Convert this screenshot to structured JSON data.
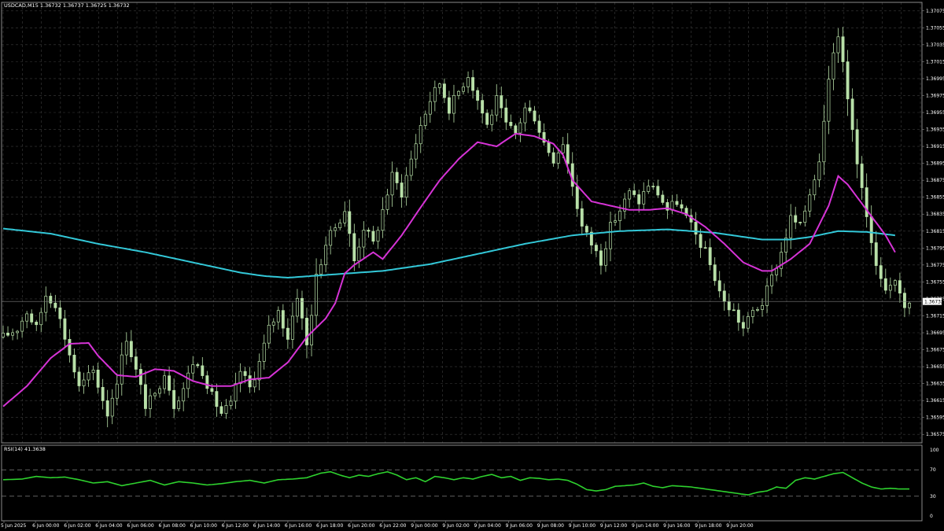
{
  "header": {
    "symbol_info": "USDCAD,M15  1.36732 1.36737 1.36725 1.36732"
  },
  "indicator": {
    "label": "RSI(14) 41.3638"
  },
  "colors": {
    "background": "#000000",
    "grid": "#3c3c3c",
    "candle_up": "#b8e0a8",
    "candle_down": "#b8e0a8",
    "ma_fast": "#d633d6",
    "ma_slow": "#33c8d8",
    "rsi": "#2ed12e",
    "text": "#ffffff"
  },
  "chart_data": {
    "type": "candlestick",
    "symbol": "USDCAD",
    "timeframe": "M15",
    "ylim": [
      1.36565,
      1.37085
    ],
    "y_ticks": [
      "1.37075",
      "1.37055",
      "1.37035",
      "1.37015",
      "1.36995",
      "1.36975",
      "1.36955",
      "1.36935",
      "1.36915",
      "1.36895",
      "1.36875",
      "1.36855",
      "1.36835",
      "1.36815",
      "1.36795",
      "1.36775",
      "1.36755",
      "1.36735",
      "1.36715",
      "1.36695",
      "1.36675",
      "1.36655",
      "1.36635",
      "1.36615",
      "1.36595",
      "1.36575"
    ],
    "current_price": "1.36732",
    "x_ticks": [
      "5 Jun 2025",
      "6 Jun 00:00",
      "6 Jun 02:00",
      "6 Jun 04:00",
      "6 Jun 06:00",
      "6 Jun 08:00",
      "6 Jun 10:00",
      "6 Jun 12:00",
      "6 Jun 14:00",
      "6 Jun 16:00",
      "6 Jun 18:00",
      "6 Jun 20:00",
      "6 Jun 22:00",
      "9 Jun 00:00",
      "9 Jun 02:00",
      "9 Jun 04:00",
      "9 Jun 06:00",
      "9 Jun 08:00",
      "9 Jun 10:00",
      "9 Jun 12:00",
      "9 Jun 14:00",
      "9 Jun 16:00",
      "9 Jun 18:00",
      "9 Jun 20:00"
    ],
    "close_path": [
      [
        0,
        1.3669
      ],
      [
        3,
        1.367
      ],
      [
        5,
        1.3672
      ],
      [
        7,
        1.367
      ],
      [
        9,
        1.3674
      ],
      [
        11,
        1.3673
      ],
      [
        13,
        1.3669
      ],
      [
        16,
        1.3663
      ],
      [
        19,
        1.3665
      ],
      [
        22,
        1.366
      ],
      [
        24,
        1.3664
      ],
      [
        26,
        1.3669
      ],
      [
        28,
        1.3665
      ],
      [
        30,
        1.3661
      ],
      [
        32,
        1.3662
      ],
      [
        34,
        1.3665
      ],
      [
        36,
        1.3661
      ],
      [
        38,
        1.3663
      ],
      [
        40,
        1.3666
      ],
      [
        42,
        1.3665
      ],
      [
        44,
        1.3662
      ],
      [
        46,
        1.366
      ],
      [
        48,
        1.3661
      ],
      [
        50,
        1.3665
      ],
      [
        52,
        1.3663
      ],
      [
        54,
        1.3666
      ],
      [
        56,
        1.367
      ],
      [
        58,
        1.3672
      ],
      [
        60,
        1.3669
      ],
      [
        62,
        1.3674
      ],
      [
        64,
        1.3668
      ],
      [
        66,
        1.3676
      ],
      [
        68,
        1.368
      ],
      [
        70,
        1.3682
      ],
      [
        72,
        1.3684
      ],
      [
        74,
        1.3678
      ],
      [
        76,
        1.3682
      ],
      [
        78,
        1.368
      ],
      [
        80,
        1.3684
      ],
      [
        82,
        1.3688
      ],
      [
        84,
        1.3686
      ],
      [
        86,
        1.369
      ],
      [
        88,
        1.3694
      ],
      [
        90,
        1.3697
      ],
      [
        92,
        1.3699
      ],
      [
        94,
        1.3696
      ],
      [
        96,
        1.3698
      ],
      [
        98,
        1.37
      ],
      [
        100,
        1.3697
      ],
      [
        102,
        1.3694
      ],
      [
        104,
        1.3697
      ],
      [
        106,
        1.3694
      ],
      [
        108,
        1.3693
      ],
      [
        110,
        1.3696
      ],
      [
        112,
        1.3695
      ],
      [
        114,
        1.3692
      ],
      [
        116,
        1.369
      ],
      [
        118,
        1.3692
      ],
      [
        120,
        1.3687
      ],
      [
        122,
        1.3682
      ],
      [
        124,
        1.368
      ],
      [
        126,
        1.3678
      ],
      [
        128,
        1.3682
      ],
      [
        130,
        1.3684
      ],
      [
        132,
        1.3686
      ],
      [
        134,
        1.3685
      ],
      [
        136,
        1.3687
      ],
      [
        138,
        1.3686
      ],
      [
        140,
        1.3684
      ],
      [
        142,
        1.3685
      ],
      [
        144,
        1.3683
      ],
      [
        146,
        1.3681
      ],
      [
        148,
        1.3679
      ],
      [
        150,
        1.3676
      ],
      [
        152,
        1.3673
      ],
      [
        154,
        1.3672
      ],
      [
        156,
        1.367
      ],
      [
        158,
        1.3672
      ],
      [
        160,
        1.3673
      ],
      [
        162,
        1.3676
      ],
      [
        164,
        1.3679
      ],
      [
        166,
        1.3683
      ],
      [
        168,
        1.3682
      ],
      [
        170,
        1.3686
      ],
      [
        172,
        1.369
      ],
      [
        174,
        1.37
      ],
      [
        176,
        1.3705
      ],
      [
        178,
        1.3697
      ],
      [
        180,
        1.369
      ],
      [
        182,
        1.3683
      ],
      [
        184,
        1.3677
      ],
      [
        186,
        1.3674
      ],
      [
        188,
        1.3676
      ],
      [
        190,
        1.3673
      ],
      [
        192,
        1.3674
      ]
    ],
    "series": [
      {
        "name": "",
        "color": "#d633d6",
        "values": [
          [
            0,
            1.36608
          ],
          [
            5,
            1.36632
          ],
          [
            10,
            1.36665
          ],
          [
            14,
            1.36682
          ],
          [
            18,
            1.36683
          ],
          [
            20,
            1.36668
          ],
          [
            24,
            1.36645
          ],
          [
            28,
            1.36643
          ],
          [
            32,
            1.36652
          ],
          [
            36,
            1.3665
          ],
          [
            40,
            1.36638
          ],
          [
            44,
            1.36632
          ],
          [
            48,
            1.36632
          ],
          [
            52,
            1.3664
          ],
          [
            56,
            1.36642
          ],
          [
            60,
            1.3666
          ],
          [
            64,
            1.3669
          ],
          [
            68,
            1.36712
          ],
          [
            70,
            1.3673
          ],
          [
            72,
            1.36765
          ],
          [
            74,
            1.36775
          ],
          [
            78,
            1.3679
          ],
          [
            80,
            1.36782
          ],
          [
            84,
            1.3681
          ],
          [
            88,
            1.36843
          ],
          [
            92,
            1.36875
          ],
          [
            96,
            1.369
          ],
          [
            100,
            1.3692
          ],
          [
            104,
            1.36915
          ],
          [
            108,
            1.3693
          ],
          [
            112,
            1.36927
          ],
          [
            116,
            1.36918
          ],
          [
            118,
            1.36905
          ],
          [
            120,
            1.36875
          ],
          [
            124,
            1.3685
          ],
          [
            128,
            1.36845
          ],
          [
            132,
            1.3684
          ],
          [
            136,
            1.3684
          ],
          [
            140,
            1.36842
          ],
          [
            144,
            1.36835
          ],
          [
            148,
            1.3682
          ],
          [
            152,
            1.368
          ],
          [
            156,
            1.36778
          ],
          [
            160,
            1.36768
          ],
          [
            162,
            1.36768
          ],
          [
            166,
            1.36782
          ],
          [
            170,
            1.368
          ],
          [
            174,
            1.36845
          ],
          [
            176,
            1.3688
          ],
          [
            178,
            1.3687
          ],
          [
            182,
            1.3684
          ],
          [
            186,
            1.3681
          ],
          [
            188,
            1.3679
          ]
        ]
      },
      {
        "name": "",
        "color": "#33c8d8",
        "values": [
          [
            0,
            1.36818
          ],
          [
            10,
            1.36812
          ],
          [
            20,
            1.368
          ],
          [
            30,
            1.3679
          ],
          [
            40,
            1.36778
          ],
          [
            50,
            1.36766
          ],
          [
            55,
            1.36762
          ],
          [
            60,
            1.3676
          ],
          [
            70,
            1.36764
          ],
          [
            80,
            1.36768
          ],
          [
            90,
            1.36776
          ],
          [
            100,
            1.36788
          ],
          [
            110,
            1.368
          ],
          [
            120,
            1.3681
          ],
          [
            130,
            1.36815
          ],
          [
            140,
            1.36817
          ],
          [
            150,
            1.36813
          ],
          [
            160,
            1.36805
          ],
          [
            166,
            1.36805
          ],
          [
            170,
            1.36808
          ],
          [
            176,
            1.36815
          ],
          [
            182,
            1.36814
          ],
          [
            188,
            1.3681
          ]
        ]
      }
    ],
    "rsi": {
      "label": "RSI(14)",
      "value": 41.3638,
      "ylim": [
        0,
        100
      ],
      "levels": [
        70,
        30
      ],
      "y_ticks": [
        "100",
        "70",
        "30",
        "0"
      ],
      "values": [
        [
          0,
          55
        ],
        [
          4,
          56
        ],
        [
          7,
          60
        ],
        [
          10,
          58
        ],
        [
          13,
          59
        ],
        [
          16,
          55
        ],
        [
          19,
          50
        ],
        [
          22,
          52
        ],
        [
          25,
          46
        ],
        [
          28,
          50
        ],
        [
          31,
          54
        ],
        [
          34,
          47
        ],
        [
          37,
          52
        ],
        [
          40,
          50
        ],
        [
          43,
          47
        ],
        [
          46,
          49
        ],
        [
          49,
          52
        ],
        [
          52,
          54
        ],
        [
          55,
          50
        ],
        [
          58,
          55
        ],
        [
          61,
          56
        ],
        [
          64,
          58
        ],
        [
          67,
          65
        ],
        [
          69,
          67
        ],
        [
          71,
          62
        ],
        [
          73,
          58
        ],
        [
          75,
          62
        ],
        [
          77,
          60
        ],
        [
          79,
          64
        ],
        [
          81,
          67
        ],
        [
          83,
          62
        ],
        [
          85,
          55
        ],
        [
          87,
          58
        ],
        [
          89,
          52
        ],
        [
          91,
          60
        ],
        [
          93,
          58
        ],
        [
          95,
          55
        ],
        [
          97,
          58
        ],
        [
          99,
          56
        ],
        [
          101,
          60
        ],
        [
          103,
          63
        ],
        [
          105,
          58
        ],
        [
          107,
          60
        ],
        [
          109,
          54
        ],
        [
          111,
          58
        ],
        [
          113,
          57
        ],
        [
          115,
          55
        ],
        [
          117,
          56
        ],
        [
          119,
          54
        ],
        [
          121,
          48
        ],
        [
          123,
          40
        ],
        [
          125,
          38
        ],
        [
          127,
          40
        ],
        [
          129,
          45
        ],
        [
          131,
          46
        ],
        [
          133,
          47
        ],
        [
          135,
          50
        ],
        [
          137,
          45
        ],
        [
          139,
          43
        ],
        [
          141,
          46
        ],
        [
          143,
          45
        ],
        [
          145,
          44
        ],
        [
          147,
          42
        ],
        [
          149,
          40
        ],
        [
          151,
          38
        ],
        [
          153,
          36
        ],
        [
          155,
          34
        ],
        [
          157,
          32
        ],
        [
          159,
          36
        ],
        [
          161,
          38
        ],
        [
          163,
          44
        ],
        [
          165,
          42
        ],
        [
          167,
          54
        ],
        [
          169,
          58
        ],
        [
          171,
          56
        ],
        [
          173,
          60
        ],
        [
          175,
          64
        ],
        [
          177,
          66
        ],
        [
          179,
          58
        ],
        [
          181,
          50
        ],
        [
          183,
          44
        ],
        [
          185,
          41
        ],
        [
          187,
          42
        ],
        [
          189,
          41
        ],
        [
          191,
          41
        ]
      ]
    }
  }
}
